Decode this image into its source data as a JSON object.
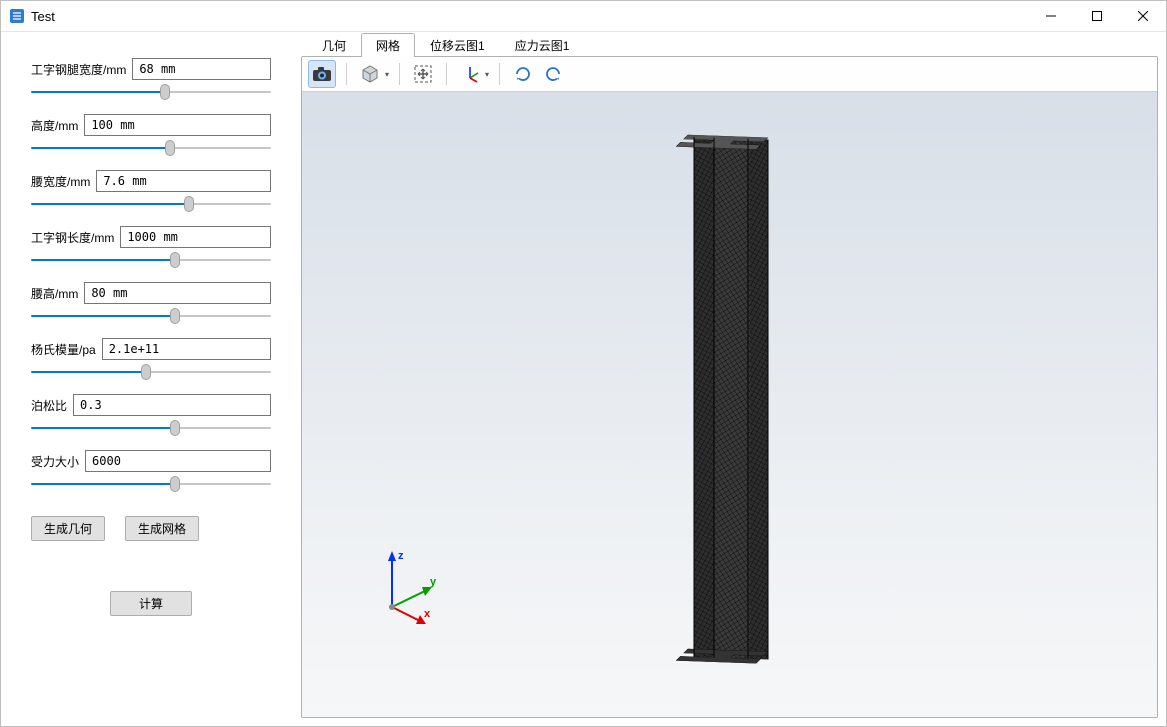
{
  "window": {
    "title": "Test"
  },
  "params": [
    {
      "label": "工字钢腿宽度/mm",
      "value": "68 mm",
      "pos": 56
    },
    {
      "label": "高度/mm",
      "value": "100 mm",
      "pos": 58
    },
    {
      "label": "腰宽度/mm",
      "value": "7.6 mm",
      "pos": 66
    },
    {
      "label": "工字钢长度/mm",
      "value": "1000 mm",
      "pos": 60
    },
    {
      "label": "腰高/mm",
      "value": "80 mm",
      "pos": 60
    },
    {
      "label": "杨氏模量/pa",
      "value": "2.1e+11",
      "pos": 48
    },
    {
      "label": "泊松比",
      "value": "0.3",
      "pos": 60
    },
    {
      "label": "受力大小",
      "value": "6000",
      "pos": 60
    }
  ],
  "buttons": {
    "gen_geometry": "生成几何",
    "gen_mesh": "生成网格",
    "calculate": "计算"
  },
  "tabs": {
    "items": [
      "几何",
      "网格",
      "位移云图1",
      "应力云图1"
    ],
    "active_index": 1
  },
  "toolbar_icons": {
    "camera": "camera-icon",
    "box": "box-view-icon",
    "fit": "fit-view-icon",
    "axes": "axes-triad-icon",
    "rotate_cw": "rotate-cw-icon",
    "rotate_ccw": "rotate-ccw-icon"
  },
  "triad": {
    "x": "x",
    "y": "y",
    "z": "z"
  }
}
